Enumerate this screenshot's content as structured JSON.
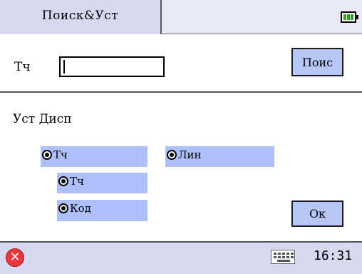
{
  "title_bar": {
    "title": "Поиск&Уст",
    "battery_icon": "battery-full-icon"
  },
  "search": {
    "label": "Тч",
    "value": "",
    "button_label": "Поис"
  },
  "display": {
    "section_label": "Уст Дисп",
    "options": {
      "left_group": "Тч",
      "left_sub_1": "Тч",
      "left_sub_2": "Код",
      "right_group": "Лин"
    }
  },
  "ok_button": "Ок",
  "taskbar": {
    "close_icon": "close-icon",
    "keyboard_icon": "keyboard-icon",
    "time": "16:31"
  }
}
